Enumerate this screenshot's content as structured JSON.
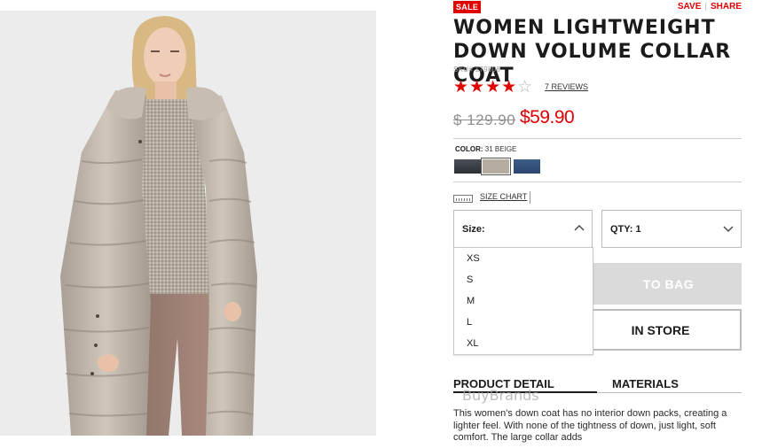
{
  "badges": {
    "sale": "SALE"
  },
  "top_links": {
    "save": "SAVE",
    "separator": "|",
    "share": "SHARE"
  },
  "product": {
    "title": "WOMEN LIGHTWEIGHT DOWN VOLUME COLLAR COAT",
    "sku": "SKU# 179808",
    "rating": {
      "filled_stars": 4,
      "total_stars": 5,
      "filled_glyphs": "★★★★",
      "empty_glyphs": "☆"
    },
    "reviews_link": "7 REVIEWS",
    "price_original": "$ 129.90",
    "price_sale": "$59.90"
  },
  "color": {
    "label": "COLOR:",
    "selected": "31 BEIGE",
    "swatches": [
      {
        "name": "dark-gray",
        "hex": "#3a4047"
      },
      {
        "name": "beige",
        "hex": "#b7aca1",
        "selected": true
      },
      {
        "name": "navy",
        "hex": "#34527c"
      }
    ]
  },
  "size_chart": {
    "label": "SIZE CHART"
  },
  "size_select": {
    "label": "Size:",
    "expanded": true,
    "options": [
      "XS",
      "S",
      "M",
      "L",
      "XL"
    ]
  },
  "qty_select": {
    "label": "QTY: 1"
  },
  "buttons": {
    "add_to_bag": "ADD TO BAG",
    "add_to_bag_visible": "TO BAG",
    "find_in_store": "FIND IN STORE",
    "find_in_store_visible": "IN STORE"
  },
  "tabs": [
    "PRODUCT DETAIL",
    "MATERIALS"
  ],
  "watermark": "BuyBrands",
  "description": "This women's down coat has no interior down packs, creating a lighter feel. With none of the tightness of down, just light, soft comfort. The large collar adds",
  "colors": {
    "accent": "#e00000",
    "text": "#1b1b1b",
    "muted": "#9a9a9a",
    "disabled_button": "#dadada"
  }
}
